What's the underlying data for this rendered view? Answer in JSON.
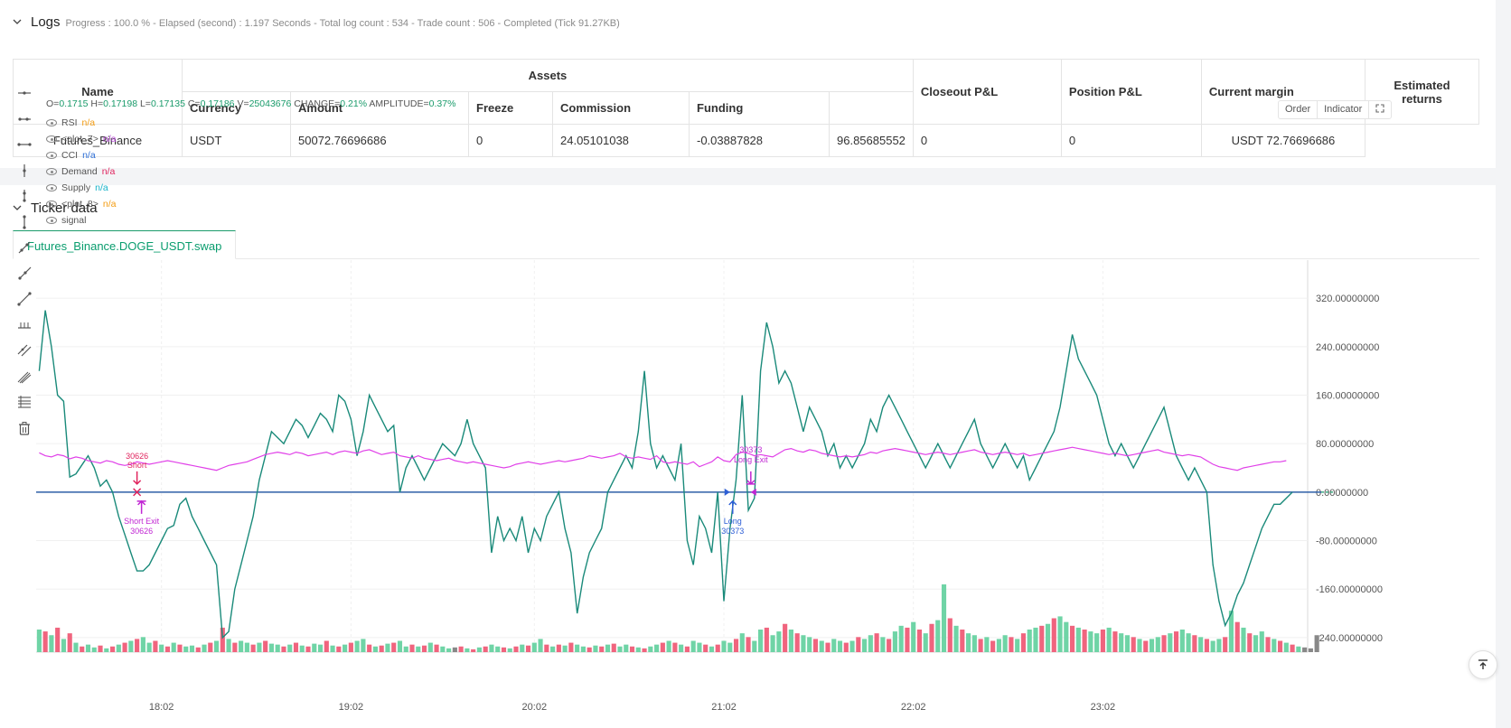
{
  "logs": {
    "title": "Logs",
    "summary": "Progress : 100.0 % - Elapsed (second) : 1.197  Seconds - Total log count : 534 - Trade count : 506 - Completed (Tick 91.27KB)"
  },
  "assets_table": {
    "group_header": "Assets",
    "headers": {
      "name": "Name",
      "currency": "Currency",
      "amount": "Amount",
      "freeze": "Freeze",
      "commission": "Commission",
      "funding": "Funding",
      "closeout": "Closeout P&L",
      "position": "Position P&L",
      "margin": "Current margin",
      "returns": "Estimated returns"
    },
    "row": {
      "name": "Futures_Binance",
      "currency": "USDT",
      "amount": "50072.76696686",
      "freeze": "0",
      "commission": "24.05101038",
      "funding": "-0.03887828",
      "closeout": "96.85685552",
      "position": "0",
      "margin": "0",
      "returns": "USDT 72.76696686"
    }
  },
  "ticker": {
    "title": "Ticker data",
    "tab": "Futures_Binance.DOGE_USDT.swap"
  },
  "ohlc": {
    "o_label": "O=",
    "o": "0.1715",
    "h_label": "H=",
    "h": "0.17198",
    "l_label": "L=",
    "l": "0.17135",
    "c_label": "C=",
    "c": "0.17186",
    "v_label": "V=",
    "v": "25043676",
    "change_label": "CHANGE=",
    "change": "0.21%",
    "amp_label": "AMPLITUDE=",
    "amp": "0.37%"
  },
  "legend": [
    {
      "name": "RSI",
      "value": "n/a",
      "color": "#f39c12"
    },
    {
      "name": "<plot_7>",
      "value": "n/a",
      "color": "#b044d0"
    },
    {
      "name": "CCI",
      "value": "n/a",
      "color": "#2e6fd6"
    },
    {
      "name": "Demand",
      "value": "n/a",
      "color": "#e0245e"
    },
    {
      "name": "Supply",
      "value": "n/a",
      "color": "#17b3c9"
    },
    {
      "name": "<plot_8>",
      "value": "n/a",
      "color": "#f39c12"
    },
    {
      "name": "signal",
      "value": "",
      "color": "#555555"
    }
  ],
  "chart_buttons": {
    "order": "Order",
    "indicator": "Indicator"
  },
  "icons": {
    "tools": [
      "horizontal-line-icon",
      "horizontal-ray-icon",
      "horizontal-segment-icon",
      "vertical-line-icon",
      "vertical-ray-icon",
      "vertical-segment-icon",
      "trend-line-icon",
      "ray-icon",
      "segment-icon",
      "price-range-icon",
      "parallel-channel-icon",
      "multi-line-icon",
      "fibonacci-icon",
      "trash-icon"
    ],
    "expand": "expand-icon",
    "scroll_top": "scroll-top-icon"
  },
  "colors": {
    "cci": "#1a8a7a",
    "rsi": "#e040e8",
    "zero_line": "#2e5fa8",
    "up": "#6fd4a6",
    "down": "#f0647e",
    "neutral": "#888888",
    "accent": "#1a9b6b"
  },
  "chart_data": {
    "type": "line",
    "y_ticks": [
      "320.00000000",
      "240.00000000",
      "160.00000000",
      "80.00000000",
      "0.00000000",
      "-80.00000000",
      "-160.00000000",
      "-240.00000000"
    ],
    "y_tick_values": [
      320,
      240,
      160,
      80,
      0,
      -80,
      -160,
      -240
    ],
    "ylim": [
      -264,
      356
    ],
    "x_ticks": [
      "18:02",
      "19:02",
      "20:02",
      "21:02",
      "22:02",
      "23:02"
    ],
    "x_tick_index": [
      20,
      51,
      81,
      112,
      143,
      174
    ],
    "series": [
      {
        "name": "CCI",
        "values": [
          200,
          300,
          240,
          160,
          150,
          25,
          30,
          45,
          60,
          40,
          10,
          20,
          0,
          -40,
          -70,
          -100,
          -130,
          -130,
          -120,
          -100,
          -80,
          -60,
          -55,
          -20,
          -10,
          -40,
          -60,
          -80,
          -100,
          -120,
          -240,
          -230,
          -160,
          -120,
          -80,
          -40,
          20,
          60,
          100,
          90,
          80,
          100,
          120,
          110,
          90,
          110,
          130,
          120,
          100,
          160,
          150,
          120,
          60,
          100,
          160,
          140,
          120,
          100,
          110,
          0,
          40,
          60,
          40,
          20,
          40,
          60,
          80,
          70,
          60,
          80,
          120,
          80,
          60,
          40,
          -100,
          -40,
          -80,
          -60,
          -80,
          -40,
          -100,
          -60,
          -80,
          -40,
          -20,
          0,
          -60,
          -100,
          -200,
          -140,
          -100,
          -80,
          -60,
          0,
          20,
          40,
          60,
          40,
          100,
          200,
          80,
          40,
          60,
          40,
          20,
          80,
          -80,
          -120,
          -40,
          -60,
          -100,
          0,
          -180,
          -60,
          20,
          160,
          -30,
          -10,
          200,
          280,
          240,
          180,
          200,
          180,
          140,
          100,
          140,
          120,
          100,
          60,
          80,
          40,
          60,
          40,
          60,
          80,
          120,
          100,
          140,
          160,
          140,
          120,
          100,
          80,
          60,
          40,
          60,
          80,
          60,
          40,
          60,
          80,
          100,
          120,
          80,
          60,
          40,
          60,
          80,
          60,
          40,
          60,
          20,
          40,
          60,
          80,
          100,
          140,
          200,
          260,
          220,
          200,
          180,
          160,
          120,
          80,
          60,
          80,
          60,
          40,
          60,
          80,
          100,
          120,
          140,
          100,
          60,
          40,
          20,
          40,
          20,
          0,
          -120,
          -180,
          -220,
          -200,
          -170,
          -150,
          -120,
          -90,
          -60,
          -40,
          -20,
          -20,
          -10,
          0
        ],
        "color": "#1a8a7a"
      },
      {
        "name": "RSI",
        "values": [
          65,
          60,
          58,
          62,
          60,
          55,
          58,
          56,
          52,
          50,
          48,
          52,
          50,
          46,
          44,
          46,
          50,
          48,
          46,
          48,
          50,
          52,
          50,
          48,
          46,
          44,
          42,
          40,
          38,
          36,
          40,
          44,
          46,
          48,
          50,
          54,
          58,
          62,
          64,
          66,
          64,
          62,
          66,
          64,
          60,
          62,
          64,
          66,
          62,
          66,
          68,
          66,
          64,
          68,
          70,
          66,
          62,
          64,
          66,
          60,
          58,
          56,
          60,
          56,
          54,
          52,
          54,
          56,
          52,
          50,
          48,
          50,
          48,
          46,
          44,
          42,
          40,
          42,
          46,
          48,
          50,
          48,
          46,
          48,
          50,
          52,
          50,
          52,
          54,
          56,
          60,
          58,
          56,
          58,
          60,
          64,
          58,
          56,
          58,
          56,
          54,
          60,
          50,
          48,
          50,
          48,
          46,
          50,
          42,
          46,
          50,
          58,
          52,
          50,
          62,
          66,
          64,
          60,
          62,
          60,
          58,
          64,
          70,
          72,
          68,
          66,
          70,
          68,
          64,
          62,
          60,
          58,
          60,
          58,
          60,
          62,
          66,
          64,
          68,
          70,
          72,
          70,
          68,
          66,
          64,
          62,
          64,
          66,
          64,
          62,
          64,
          66,
          68,
          70,
          66,
          64,
          62,
          64,
          66,
          64,
          62,
          64,
          60,
          62,
          64,
          66,
          68,
          70,
          72,
          74,
          72,
          70,
          68,
          66,
          64,
          62,
          64,
          62,
          60,
          62,
          64,
          66,
          68,
          70,
          66,
          64,
          62,
          60,
          62,
          60,
          58,
          52,
          46,
          42,
          40,
          38,
          36,
          40,
          42,
          44,
          46,
          48,
          50,
          50,
          52
        ],
        "color": "#e040e8"
      }
    ],
    "volumes": [
      24,
      22,
      18,
      26,
      14,
      20,
      10,
      6,
      8,
      5,
      7,
      4,
      6,
      8,
      10,
      12,
      14,
      16,
      10,
      12,
      8,
      6,
      10,
      8,
      6,
      7,
      5,
      8,
      10,
      12,
      26,
      14,
      10,
      12,
      10,
      8,
      10,
      12,
      9,
      8,
      6,
      8,
      10,
      7,
      6,
      9,
      8,
      12,
      7,
      6,
      8,
      10,
      12,
      14,
      8,
      6,
      7,
      9,
      10,
      12,
      6,
      8,
      6,
      7,
      10,
      8,
      6,
      4,
      5,
      6,
      4,
      3,
      5,
      6,
      8,
      6,
      5,
      4,
      6,
      8,
      7,
      10,
      14,
      8,
      6,
      8,
      7,
      10,
      8,
      6,
      5,
      7,
      6,
      8,
      9,
      6,
      8,
      6,
      5,
      4,
      6,
      8,
      10,
      12,
      10,
      8,
      6,
      12,
      10,
      8,
      6,
      8,
      12,
      10,
      14,
      20,
      16,
      12,
      24,
      26,
      18,
      22,
      30,
      24,
      20,
      18,
      16,
      14,
      12,
      10,
      14,
      12,
      10,
      12,
      16,
      14,
      18,
      20,
      16,
      14,
      22,
      28,
      26,
      32,
      24,
      20,
      30,
      34,
      72,
      36,
      28,
      24,
      20,
      18,
      14,
      16,
      12,
      14,
      18,
      16,
      14,
      20,
      24,
      26,
      28,
      30,
      36,
      38,
      32,
      28,
      26,
      24,
      22,
      20,
      24,
      26,
      22,
      20,
      18,
      16,
      14,
      12,
      14,
      16,
      18,
      20,
      22,
      24,
      20,
      18,
      16,
      14,
      12,
      14,
      16,
      44,
      32,
      26,
      20,
      18,
      22,
      16,
      14,
      12,
      10,
      8,
      6,
      5,
      4,
      18
    ],
    "volume_dir": [
      "u",
      "d",
      "u",
      "d",
      "u",
      "d",
      "u",
      "d",
      "u",
      "u",
      "d",
      "u",
      "d",
      "u",
      "d",
      "u",
      "d",
      "u",
      "u",
      "d",
      "u",
      "d",
      "u",
      "d",
      "u",
      "u",
      "d",
      "u",
      "d",
      "u",
      "d",
      "u",
      "d",
      "u",
      "u",
      "d",
      "u",
      "d",
      "u",
      "u",
      "d",
      "u",
      "d",
      "u",
      "d",
      "u",
      "u",
      "d",
      "u",
      "d",
      "u",
      "d",
      "u",
      "u",
      "d",
      "u",
      "d",
      "u",
      "d",
      "u",
      "u",
      "d",
      "u",
      "d",
      "u",
      "d",
      "u",
      "u",
      "n",
      "d",
      "u",
      "d",
      "u",
      "d",
      "u",
      "u",
      "d",
      "u",
      "d",
      "u",
      "d",
      "u",
      "u",
      "d",
      "u",
      "d",
      "u",
      "d",
      "u",
      "u",
      "d",
      "u",
      "d",
      "u",
      "d",
      "u",
      "u",
      "d",
      "u",
      "d",
      "u",
      "u",
      "d",
      "u",
      "d",
      "u",
      "d",
      "u",
      "u",
      "d",
      "u",
      "d",
      "u",
      "u",
      "d",
      "u",
      "d",
      "u",
      "u",
      "d",
      "u",
      "u",
      "d",
      "u",
      "d",
      "u",
      "u",
      "d",
      "u",
      "d",
      "u",
      "u",
      "d",
      "u",
      "d",
      "u",
      "u",
      "d",
      "u",
      "d",
      "u",
      "u",
      "d",
      "u",
      "d",
      "u",
      "d",
      "u",
      "u",
      "d",
      "u",
      "d",
      "u",
      "u",
      "d",
      "u",
      "d",
      "u",
      "u",
      "d",
      "u",
      "d",
      "u",
      "u",
      "d",
      "u",
      "d",
      "u",
      "u",
      "d",
      "u",
      "d",
      "u",
      "u",
      "d",
      "u",
      "d",
      "u",
      "u",
      "d",
      "u",
      "d",
      "u",
      "u",
      "d",
      "u",
      "d",
      "u",
      "u",
      "d",
      "u",
      "d",
      "u",
      "u",
      "d",
      "u",
      "d",
      "u",
      "d",
      "u",
      "u",
      "d",
      "u",
      "d",
      "u",
      "d",
      "u"
    ],
    "signals": [
      {
        "label": "Short",
        "price": "30626",
        "index": 16,
        "kind": "entry-short"
      },
      {
        "label": "Short Exit",
        "price": "30626",
        "index": 16,
        "kind": "exit-short"
      },
      {
        "label": "Long",
        "price": "30373",
        "index": 113,
        "kind": "entry-long"
      },
      {
        "label": "Long Exit",
        "price": "30373",
        "index": 117,
        "kind": "exit-long"
      }
    ]
  }
}
